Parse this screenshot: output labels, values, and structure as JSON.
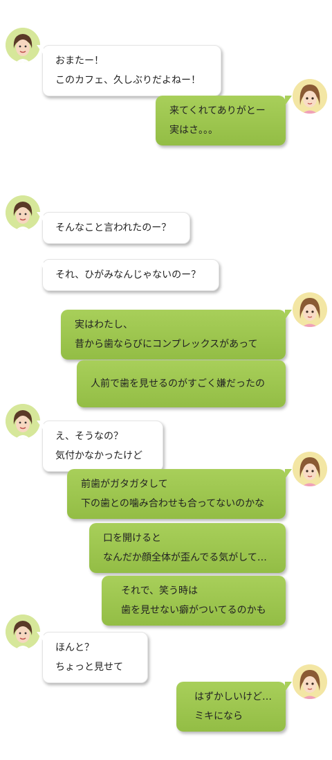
{
  "messages": [
    {
      "speaker": "friend",
      "lines": [
        "おまたー！",
        "このカフェ、久しぶりだよねー！"
      ]
    },
    {
      "speaker": "me",
      "lines": [
        "来てくれてありがとー",
        "実はさ。。。"
      ]
    },
    {
      "speaker": "friend",
      "lines": [
        "そんなこと言われたのー？"
      ]
    },
    {
      "speaker": "friend",
      "lines": [
        "それ、ひがみなんじゃないのー？"
      ]
    },
    {
      "speaker": "me",
      "lines": [
        "実はわたし、",
        "昔から歯ならびにコンプレックスがあって"
      ]
    },
    {
      "speaker": "me",
      "lines": [
        "人前で歯を見せるのがすごく嫌だったの"
      ]
    },
    {
      "speaker": "friend",
      "lines": [
        "え、そうなの？",
        "気付かなかったけど"
      ]
    },
    {
      "speaker": "me",
      "lines": [
        "前歯がガタガタして",
        "下の歯との噛み合わせも合ってないのかな"
      ]
    },
    {
      "speaker": "me",
      "lines": [
        "口を開けると",
        "なんだか顔全体が歪んでる気がして…"
      ]
    },
    {
      "speaker": "me",
      "lines": [
        "それで、笑う時は",
        "歯を見せない癖がついてるのかも"
      ]
    },
    {
      "speaker": "friend",
      "lines": [
        "ほんと？",
        "ちょっと見せて"
      ]
    },
    {
      "speaker": "me",
      "lines": [
        "はずかしいけど…",
        "ミキになら"
      ]
    }
  ],
  "colors": {
    "me_bubble": "#a8cf5a",
    "friend_bubble": "#ffffff"
  },
  "avatars": {
    "friend": "avatar-friend",
    "me": "avatar-me"
  }
}
